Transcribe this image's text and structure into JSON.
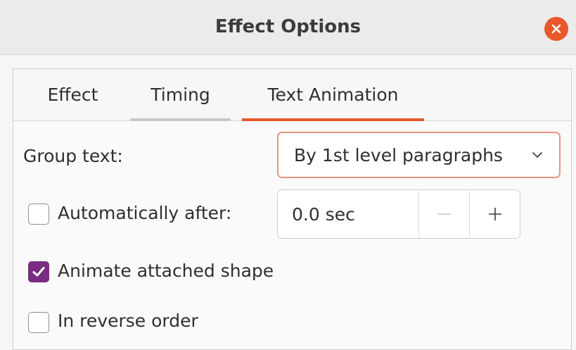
{
  "window": {
    "title": "Effect Options",
    "close_icon": "close-icon",
    "accent_color": "#e9572b"
  },
  "tabs": [
    {
      "label": "Effect",
      "active": false
    },
    {
      "label": "Timing",
      "active": false
    },
    {
      "label": "Text Animation",
      "active": true
    }
  ],
  "group_text": {
    "label": "Group text:",
    "selected": "By 1st level paragraphs",
    "icon": "chevron-down-icon"
  },
  "auto_after": {
    "label": "Automatically after:",
    "checked": false,
    "value": "0.0 sec",
    "decrement_icon": "minus-icon",
    "increment_icon": "plus-icon"
  },
  "animate_shape": {
    "label": "Animate attached shape",
    "checked": true,
    "check_color": "#792c81"
  },
  "reverse_order": {
    "label": "In reverse order",
    "checked": false
  }
}
